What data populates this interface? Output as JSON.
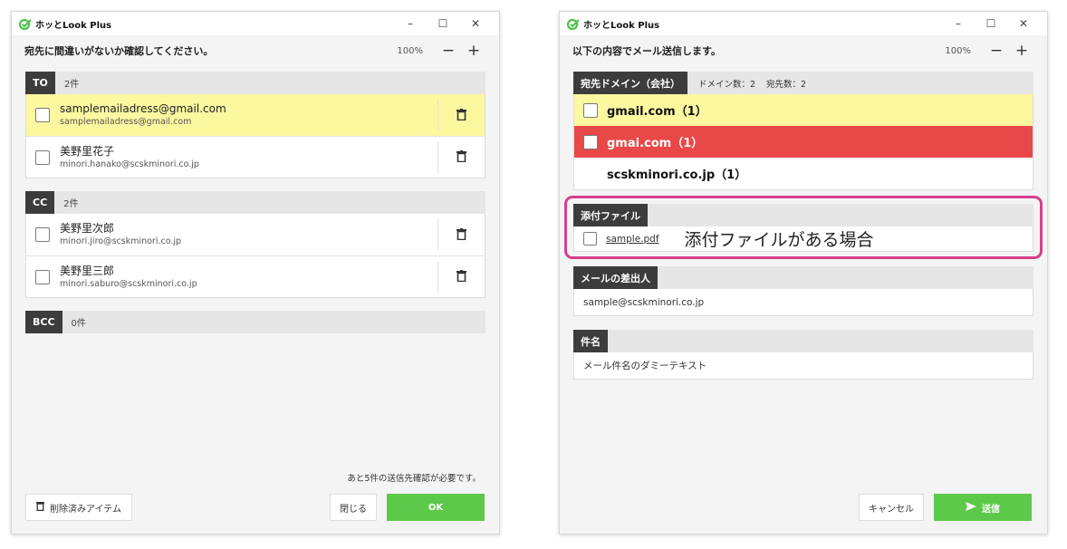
{
  "left": {
    "app_title": "ホッとLook Plus",
    "heading": "宛先に間違いがないか確認してください。",
    "zoom": "100%",
    "sections": {
      "to": {
        "tag": "TO",
        "count": "2件",
        "items": [
          {
            "name": "samplemailadress@gmail.com",
            "address": "samplemailadress@gmail.com"
          },
          {
            "name": "美野里花子",
            "address": "minori.hanako@scskminori.co.jp"
          }
        ]
      },
      "cc": {
        "tag": "CC",
        "count": "2件",
        "items": [
          {
            "name": "美野里次郎",
            "address": "minori.jiro@scskminori.co.jp"
          },
          {
            "name": "美野里三郎",
            "address": "minori.saburo@scskminori.co.jp"
          }
        ]
      },
      "bcc": {
        "tag": "BCC",
        "count": "0件"
      }
    },
    "footer_note": "あと5件の送信先確認が必要です。",
    "deleted_items_label": "削除済みアイテム",
    "close_label": "閉じる",
    "ok_label": "OK"
  },
  "right": {
    "app_title": "ホッとLook Plus",
    "heading": "以下の内容でメール送信します。",
    "zoom": "100%",
    "domains": {
      "tag": "宛先ドメイン（会社）",
      "domain_count": "ドメイン数：2",
      "recipient_count": "宛先数：2",
      "items": [
        {
          "label": "gmail.com（1）",
          "status": "highlight"
        },
        {
          "label": "gmai.com（1）",
          "status": "warning"
        },
        {
          "label": "scskminori.co.jp（1）",
          "status": "normal"
        }
      ]
    },
    "attachment": {
      "tag": "添付ファイル",
      "file": "sample.pdf",
      "note": "添付ファイルがある場合"
    },
    "sender": {
      "tag": "メールの差出人",
      "value": "sample@scskminori.co.jp"
    },
    "subject": {
      "tag": "件名",
      "value": "メール件名のダミーテキスト"
    },
    "cancel_label": "キャンセル",
    "send_label": "送信"
  },
  "colors": {
    "accent_green": "#5dc94b",
    "highlight_yellow": "#fbf8a0",
    "warning_red": "#e94848",
    "frame_pink": "#d6408c"
  }
}
